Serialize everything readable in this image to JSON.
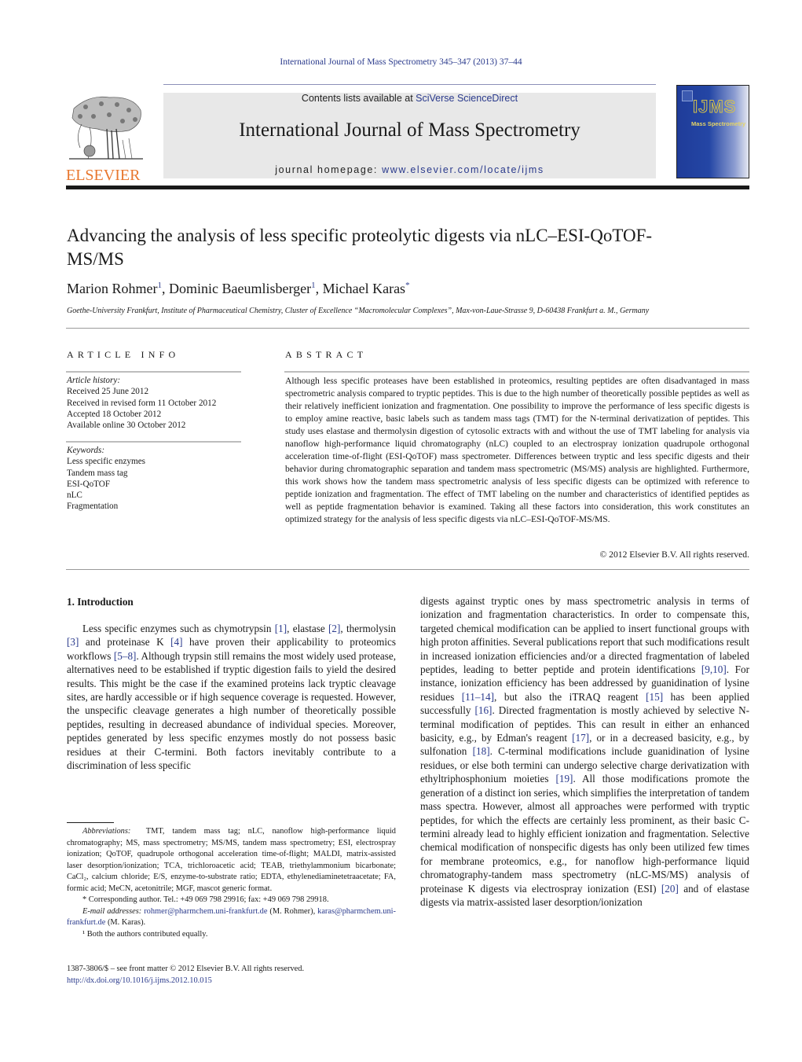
{
  "header": {
    "journal_ref": "International Journal of Mass Spectrometry 345–347 (2013) 37–44",
    "contents_prefix": "Contents lists available at ",
    "contents_link": "SciVerse ScienceDirect",
    "journal_title": "International Journal of Mass Spectrometry",
    "homepage_prefix": "journal homepage: ",
    "homepage_link": "www.elsevier.com/locate/ijms",
    "publisher_wordmark": "ELSEVIER",
    "cover_logo": "IJMS",
    "cover_subtitle": "Mass Spectrometry"
  },
  "article": {
    "title": "Advancing the analysis of less specific proteolytic digests via nLC–ESI-QoTOF-MS/MS",
    "authors": [
      {
        "name": "Marion Rohmer",
        "mark": "1"
      },
      {
        "name": "Dominic Baeumlisberger",
        "mark": "1"
      },
      {
        "name": "Michael Karas",
        "mark": "*"
      }
    ],
    "separator": ", ",
    "affiliation": "Goethe-University Frankfurt, Institute of Pharmaceutical Chemistry, Cluster of Excellence “Macromolecular Complexes”, Max-von-Laue-Strasse 9, D-60438 Frankfurt a. M., Germany"
  },
  "article_info": {
    "heading": "ARTICLE INFO",
    "history_label": "Article history:",
    "history": [
      "Received 25 June 2012",
      "Received in revised form 11 October 2012",
      "Accepted 18 October 2012",
      "Available online 30 October 2012"
    ],
    "keywords_label": "Keywords:",
    "keywords": [
      "Less specific enzymes",
      "Tandem mass tag",
      "ESI-QoTOF",
      "nLC",
      "Fragmentation"
    ]
  },
  "abstract": {
    "heading": "ABSTRACT",
    "text": "Although less specific proteases have been established in proteomics, resulting peptides are often disadvantaged in mass spectrometric analysis compared to tryptic peptides. This is due to the high number of theoretically possible peptides as well as their relatively inefficient ionization and fragmentation. One possibility to improve the performance of less specific digests is to employ amine reactive, basic labels such as tandem mass tags (TMT) for the N-terminal derivatization of peptides. This study uses elastase and thermolysin digestion of cytosolic extracts with and without the use of TMT labeling for analysis via nanoflow high-performance liquid chromatography (nLC) coupled to an electrospray ionization quadrupole orthogonal acceleration time-of-flight (ESI-QoTOF) mass spectrometer. Differences between tryptic and less specific digests and their behavior during chromatographic separation and tandem mass spectrometric (MS/MS) analysis are highlighted. Furthermore, this work shows how the tandem mass spectrometric analysis of less specific digests can be optimized with reference to peptide ionization and fragmentation. The effect of TMT labeling on the number and characteristics of identified peptides as well as peptide fragmentation behavior is examined. Taking all these factors into consideration, this work constitutes an optimized strategy for the analysis of less specific digests via nLC–ESI-QoTOF-MS/MS.",
    "copyright": "© 2012 Elsevier B.V. All rights reserved."
  },
  "introduction": {
    "heading": "1.  Introduction",
    "left_segments": [
      {
        "t": "Less specific enzymes such as chymotrypsin "
      },
      {
        "ref": "[1]"
      },
      {
        "t": ", elastase "
      },
      {
        "ref": "[2]"
      },
      {
        "t": ", thermolysin "
      },
      {
        "ref": "[3]"
      },
      {
        "t": " and proteinase K "
      },
      {
        "ref": "[4]"
      },
      {
        "t": " have proven their applicability to proteomics workflows "
      },
      {
        "ref": "[5–8]"
      },
      {
        "t": ". Although trypsin still remains the most widely used protease, alternatives need to be established if tryptic digestion fails to yield the desired results. This might be the case if the examined proteins lack tryptic cleavage sites, are hardly accessible or if high sequence coverage is requested. However, the unspecific cleavage generates a high number of theoretically possible peptides, resulting in decreased abundance of individual species. Moreover, peptides generated by less specific enzymes mostly do not possess basic residues at their C-termini. Both factors inevitably contribute to a discrimination of less specific"
      }
    ],
    "right_segments": [
      {
        "t": "digests against tryptic ones by mass spectrometric analysis in terms of ionization and fragmentation characteristics. In order to compensate this, targeted chemical modification can be applied to insert functional groups with high proton affinities. Several publications report that such modifications result in increased ionization efficiencies and/or a directed fragmentation of labeled peptides, leading to better peptide and protein identifications "
      },
      {
        "ref": "[9,10]"
      },
      {
        "t": ". For instance, ionization efficiency has been addressed by guanidination of lysine residues "
      },
      {
        "ref": "[11–14]"
      },
      {
        "t": ", but also the iTRAQ reagent "
      },
      {
        "ref": "[15]"
      },
      {
        "t": " has been applied successfully "
      },
      {
        "ref": "[16]"
      },
      {
        "t": ". Directed fragmentation is mostly achieved by selective N-terminal modification of peptides. This can result in either an enhanced basicity, e.g., by Edman's reagent "
      },
      {
        "ref": "[17]"
      },
      {
        "t": ", or in a decreased basicity, e.g., by sulfonation "
      },
      {
        "ref": "[18]"
      },
      {
        "t": ". C-terminal modifications include guanidination of lysine residues, or else both termini can undergo selective charge derivatization with ethyltriphosphonium moieties "
      },
      {
        "ref": "[19]"
      },
      {
        "t": ". All those modifications promote the generation of a distinct ion series, which simplifies the interpretation of tandem mass spectra. However, almost all approaches were performed with tryptic peptides, for which the effects are certainly less prominent, as their basic C-termini already lead to highly efficient ionization and fragmentation. Selective chemical modification of nonspecific digests has only been utilized few times for membrane proteomics, e.g., for nanoflow high-performance liquid chromatography-tandem mass spectrometry (nLC-MS/MS) analysis of proteinase K digests via electrospray ionization (ESI) "
      },
      {
        "ref": "[20]"
      },
      {
        "t": " and of elastase digests via matrix-assisted laser desorption/ionization"
      }
    ]
  },
  "footnotes": {
    "abbreviations_label": "Abbreviations:",
    "abbreviations": "TMT, tandem mass tag; nLC, nanoflow high-performance liquid chromatography; MS, mass spectrometry; MS/MS, tandem mass spectrometry; ESI, electrospray ionization; QoTOF, quadrupole orthogonal acceleration time-of-flight; MALDI, matrix-assisted laser desorption/ionization; TCA, trichloroacetic acid; TEAB, triethylammonium bicarbonate; CaCl₂, calcium chloride; E/S, enzyme-to-substrate ratio; EDTA, ethylenediaminetetraacetate; FA, formic acid; MeCN, acetonitrile; MGF, mascot generic format.",
    "corresponding": "* Corresponding author. Tel.: +49 069 798 29916; fax: +49 069 798 29918.",
    "email_label": "E-mail addresses:",
    "email_1": "rohmer@pharmchem.uni-frankfurt.de",
    "email_1_owner": " (M. Rohmer),",
    "email_2": "karas@pharmchem.uni-frankfurt.de",
    "email_2_owner": " (M. Karas).",
    "equal_contrib": "¹  Both the authors contributed equally.",
    "front_matter": "1387-3806/$ – see front matter © 2012 Elsevier B.V. All rights reserved.",
    "doi": "http://dx.doi.org/10.1016/j.ijms.2012.10.015"
  }
}
